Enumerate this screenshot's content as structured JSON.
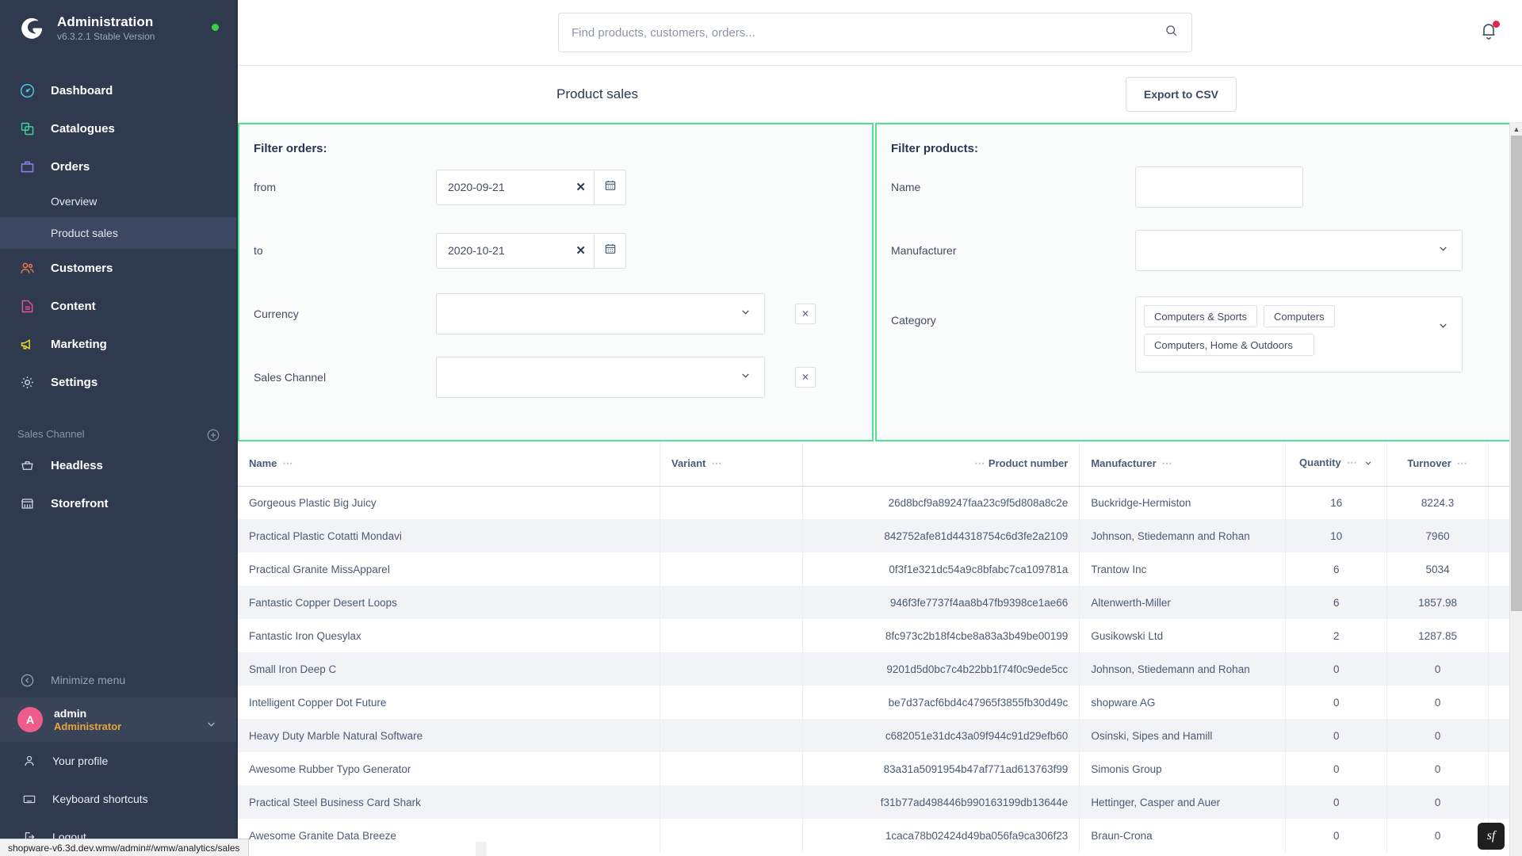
{
  "sidebar": {
    "brand": {
      "title": "Administration",
      "version": "v6.3.2.1 Stable Version",
      "logo_icon": "shopware-logo-icon",
      "status_icon": "status-dot-icon"
    },
    "items": [
      {
        "label": "Dashboard",
        "icon": "dashboard-gauge-icon"
      },
      {
        "label": "Catalogues",
        "icon": "catalogues-layers-icon"
      },
      {
        "label": "Orders",
        "icon": "orders-bag-icon"
      }
    ],
    "orders_sub": [
      {
        "label": "Overview"
      },
      {
        "label": "Product sales"
      }
    ],
    "items2": [
      {
        "label": "Customers",
        "icon": "customers-people-icon"
      },
      {
        "label": "Content",
        "icon": "content-document-icon"
      },
      {
        "label": "Marketing",
        "icon": "marketing-megaphone-icon"
      },
      {
        "label": "Settings",
        "icon": "settings-gear-icon"
      }
    ],
    "sales_channel_group": {
      "label": "Sales Channel",
      "add_icon": "plus-circle-icon"
    },
    "sales_channels": [
      {
        "label": "Headless",
        "icon": "headless-basket-icon"
      },
      {
        "label": "Storefront",
        "icon": "storefront-shop-icon"
      }
    ],
    "minimize": {
      "label": "Minimize menu",
      "icon": "collapse-left-icon"
    },
    "user": {
      "initial": "A",
      "name": "admin",
      "role": "Administrator",
      "caret_icon": "chevron-down-icon"
    },
    "footer_items": [
      {
        "label": "Your profile",
        "icon": "user-icon"
      },
      {
        "label": "Keyboard shortcuts",
        "icon": "keyboard-icon"
      },
      {
        "label": "Logout",
        "icon": "logout-icon"
      }
    ]
  },
  "statusbar": {
    "url": "shopware-v6.3d.dev.wmw/admin#/wmw/analytics/sales"
  },
  "topbar": {
    "search_placeholder": "Find products, customers, orders...",
    "search_value": "",
    "search_icon": "search-icon",
    "bell_icon": "notification-bell-icon"
  },
  "pagehead": {
    "title": "Product sales",
    "export_label": "Export to CSV"
  },
  "filter_orders": {
    "heading": "Filter orders:",
    "from": {
      "label": "from",
      "value": "2020-09-21",
      "clear_icon": "clear-x-icon",
      "calendar_icon": "calendar-icon"
    },
    "to": {
      "label": "to",
      "value": "2020-10-21",
      "clear_icon": "clear-x-icon",
      "calendar_icon": "calendar-icon"
    },
    "currency": {
      "label": "Currency",
      "value": "",
      "chevron_icon": "chevron-down-icon",
      "reset_icon": "reset-x-icon"
    },
    "sales_channel": {
      "label": "Sales Channel",
      "value": "",
      "chevron_icon": "chevron-down-icon",
      "reset_icon": "reset-x-icon"
    }
  },
  "filter_products": {
    "heading": "Filter products:",
    "name": {
      "label": "Name",
      "value": ""
    },
    "manufacturer": {
      "label": "Manufacturer",
      "value": "",
      "chevron_icon": "chevron-down-icon"
    },
    "category": {
      "label": "Category",
      "chips": [
        "Computers & Sports",
        "Computers",
        "Computers, Home & Outdoors"
      ],
      "chevron_icon": "chevron-down-icon"
    }
  },
  "table": {
    "columns": [
      {
        "key": "name",
        "label": "Name",
        "align": "left",
        "menu_icon": "column-menu-icon"
      },
      {
        "key": "variant",
        "label": "Variant",
        "align": "left",
        "menu_icon": "column-menu-icon"
      },
      {
        "key": "product_number",
        "label": "Product number",
        "align": "right",
        "menu_icon": "column-menu-icon"
      },
      {
        "key": "manufacturer",
        "label": "Manufacturer",
        "align": "left",
        "menu_icon": "column-menu-icon"
      },
      {
        "key": "quantity",
        "label": "Quantity",
        "align": "center",
        "menu_icon": "column-menu-icon",
        "sort_icon": "sort-desc-icon"
      },
      {
        "key": "turnover",
        "label": "Turnover",
        "align": "center",
        "menu_icon": "column-menu-icon"
      }
    ],
    "rows": [
      {
        "name": "Gorgeous Plastic Big Juicy",
        "variant": "",
        "product_number": "26d8bcf9a89247faa23c9f5d808a8c2e",
        "manufacturer": "Buckridge-Hermiston",
        "quantity": "16",
        "turnover": "8224.3"
      },
      {
        "name": "Practical Plastic Cotatti Mondavi",
        "variant": "",
        "product_number": "842752afe81d44318754c6d3fe2a2109",
        "manufacturer": "Johnson, Stiedemann and Rohan",
        "quantity": "10",
        "turnover": "7960"
      },
      {
        "name": "Practical Granite MissApparel",
        "variant": "",
        "product_number": "0f3f1e321dc54a9c8bfabc7ca109781a",
        "manufacturer": "Trantow Inc",
        "quantity": "6",
        "turnover": "5034"
      },
      {
        "name": "Fantastic Copper Desert Loops",
        "variant": "",
        "product_number": "946f3fe7737f4aa8b47fb9398ce1ae66",
        "manufacturer": "Altenwerth-Miller",
        "quantity": "6",
        "turnover": "1857.98"
      },
      {
        "name": "Fantastic Iron Quesylax",
        "variant": "",
        "product_number": "8fc973c2b18f4cbe8a83a3b49be00199",
        "manufacturer": "Gusikowski Ltd",
        "quantity": "2",
        "turnover": "1287.85"
      },
      {
        "name": "Small Iron Deep C",
        "variant": "",
        "product_number": "9201d5d0bc7c4b22bb1f74f0c9ede5cc",
        "manufacturer": "Johnson, Stiedemann and Rohan",
        "quantity": "0",
        "turnover": "0"
      },
      {
        "name": "Intelligent Copper Dot Future",
        "variant": "",
        "product_number": "be7d37acf6bd4c47965f3855fb30d49c",
        "manufacturer": "shopware AG",
        "quantity": "0",
        "turnover": "0"
      },
      {
        "name": "Heavy Duty Marble Natural Software",
        "variant": "",
        "product_number": "c682051e31dc43a09f944c91d29efb60",
        "manufacturer": "Osinski, Sipes and Hamill",
        "quantity": "0",
        "turnover": "0"
      },
      {
        "name": "Awesome Rubber Typo Generator",
        "variant": "",
        "product_number": "83a31a5091954b47af771ad613763f99",
        "manufacturer": "Simonis Group",
        "quantity": "0",
        "turnover": "0"
      },
      {
        "name": "Practical Steel Business Card Shark",
        "variant": "",
        "product_number": "f31b77ad498446b990163199db13644e",
        "manufacturer": "Hettinger, Casper and Auer",
        "quantity": "0",
        "turnover": "0"
      },
      {
        "name": "Awesome Granite Data Breeze",
        "variant": "",
        "product_number": "1caca78b02424d49ba056fa9ca306f23",
        "manufacturer": "Braun-Crona",
        "quantity": "0",
        "turnover": "0"
      }
    ]
  },
  "colors": {
    "sidebar_bg": "#303a4f",
    "sidebar_active": "#3d4761",
    "accent_green": "#56e092",
    "avatar_pink": "#ed5c8b",
    "role_orange": "#e8a33d",
    "status_green": "#37d046",
    "badge_red": "#de294c"
  },
  "framework_badge": {
    "label": "sf",
    "name": "symfony-profiler-badge"
  }
}
